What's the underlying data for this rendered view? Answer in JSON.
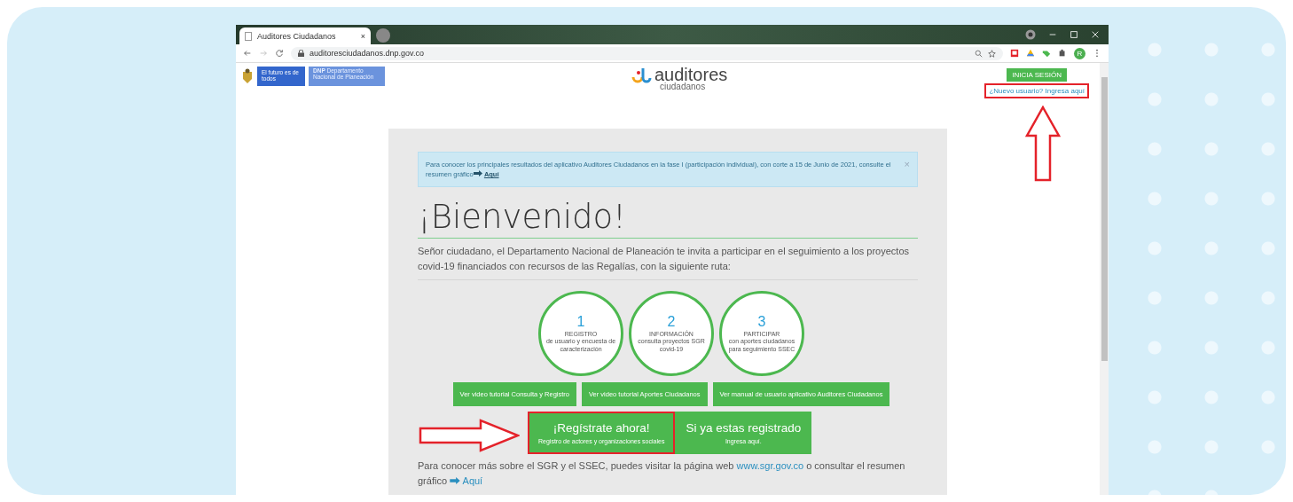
{
  "browser": {
    "tab_title": "Auditores Ciudadanos",
    "tab_close": "×",
    "url": "auditoresciudadanos.dnp.gov.co",
    "profile_initial": "R"
  },
  "header": {
    "brand_text": "El futuro es de todos",
    "agency_short": "DNP",
    "agency_name": "Departamento Nacional de Planeación",
    "logo_title": "auditores",
    "logo_subtitle": "ciudadanos",
    "login_button": "INICIA SESIÓN",
    "register_link": {
      "text": "¿Nuevo usuario? Ingresa aquí",
      "highlighted": true
    }
  },
  "alert": {
    "text": "Para conocer los principales resultados del aplicativo Auditores Ciudadanos en la fase I (participación individual), con corte a 15 de Junio de 2021, consulte el resumen gráfico",
    "link": "Aquí",
    "close": "×"
  },
  "title": "¡Bienvenido!",
  "intro": "Señor ciudadano, el Departamento Nacional de Planeación te invita a participar en el seguimiento a los proyectos covid-19 financiados con recursos de las Regalías, con la siguiente ruta:",
  "steps": [
    {
      "number": "1",
      "title": "REGISTRO",
      "description": "de usuario y encuesta de caracterización"
    },
    {
      "number": "2",
      "title": "INFORMACIÓN",
      "description": "consulta proyectos SGR covid-19"
    },
    {
      "number": "3",
      "title": "PARTICIPAR",
      "description": "con aportes ciudadanos para seguimiento SSEC"
    }
  ],
  "tutorial_buttons": [
    "Ver video tutorial Consulta y Registro",
    "Ver video tutorial Aportes Ciudadanos",
    "Ver manual de usuario aplicativo Auditores Ciudadanos"
  ],
  "cta_buttons": [
    {
      "title": "¡Regístrate ahora!",
      "subtitle": "Registro de actores y organizaciones sociales",
      "highlighted": true
    },
    {
      "title": "Si ya estas registrado",
      "subtitle": "Ingresa aquí.",
      "highlighted": false
    }
  ],
  "footer": {
    "text_before": "Para conocer más sobre el SGR y el SSEC, puedes visitar la página web",
    "site_link": "www.sgr.gov.co",
    "text_middle": "o consultar el resumen gráfico",
    "link": "Aquí"
  }
}
